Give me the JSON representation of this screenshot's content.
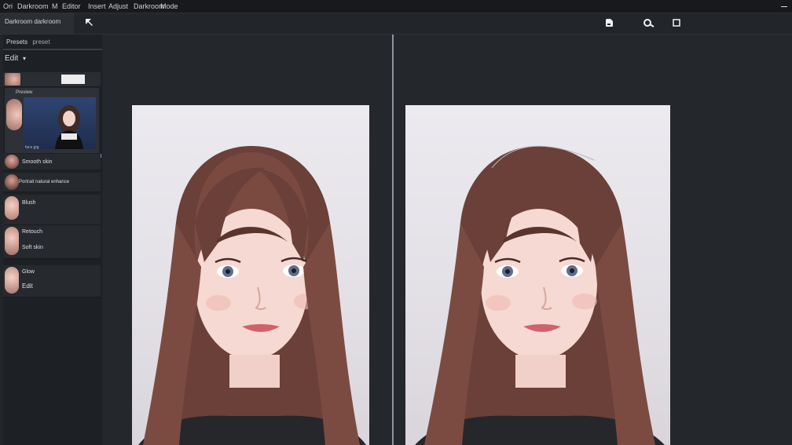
{
  "menubar": {
    "items": [
      "Ori",
      "Darkroom",
      "M",
      "Editor",
      "Insert",
      "Adjust",
      "Darkroom",
      "Mode"
    ]
  },
  "toolbar": {
    "doc_tab": "Darkroom darkroom",
    "back_icon": "arrow-up-left-icon",
    "icons": [
      "save-icon",
      "brush-icon",
      "square-icon"
    ]
  },
  "sidebar": {
    "section_label": "Presets",
    "section_sub": "preset",
    "header": "Edit",
    "header_sub": "▾",
    "preview_caption": "Preview",
    "preview_sub": "face.jpg",
    "rows": [
      {
        "title": "Smooth skin",
        "sub": ""
      },
      {
        "title": "Portrait natural enhance",
        "sub": ""
      },
      {
        "title": "Blush",
        "sub": ""
      },
      {
        "title": "Retouch",
        "sub": "Soft skin"
      },
      {
        "title": "Glow",
        "sub": "Edit"
      }
    ]
  },
  "colors": {
    "background": "#22252a",
    "sidebar": "#1d2024",
    "hair": "#6a4038",
    "skin": "#f5d9d2"
  }
}
